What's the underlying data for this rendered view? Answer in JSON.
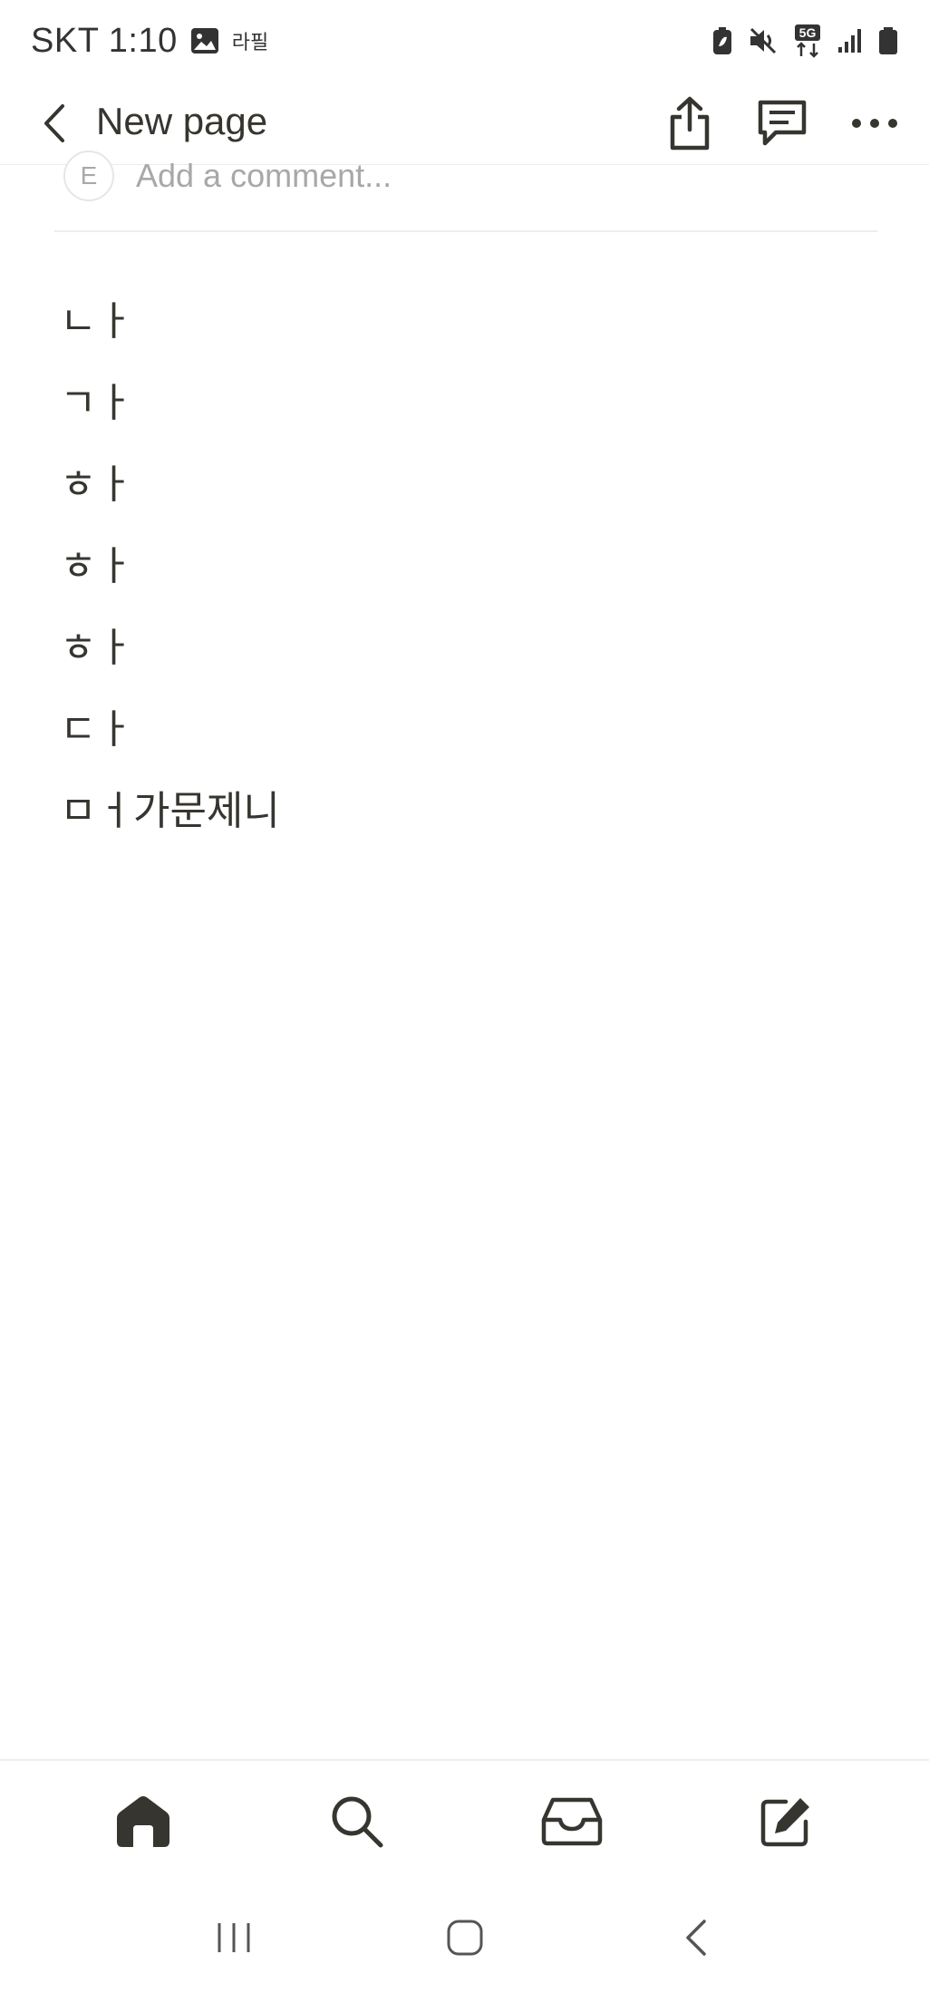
{
  "status_bar": {
    "carrier_time": "SKT 1:10",
    "notification_badge": "라필",
    "network": "5G",
    "icons": [
      "image-icon",
      "battery-saver-icon",
      "mute-icon",
      "5g-data-icon",
      "signal-icon",
      "battery-icon"
    ]
  },
  "app_bar": {
    "title": "New page",
    "actions": [
      "share-icon",
      "comment-icon",
      "more-icon"
    ]
  },
  "comment": {
    "avatar_initial": "E",
    "placeholder": "Add a comment..."
  },
  "content": {
    "lines": [
      "ㄴㅏ",
      "ㄱㅏ",
      "ㅎㅏ",
      "ㅎㅏ",
      "ㅎㅏ",
      "ㄷㅏ",
      "ㅁㅓ가문제니"
    ]
  },
  "bottom_nav": {
    "items": [
      "home-icon",
      "search-icon",
      "inbox-icon",
      "new-page-icon"
    ]
  },
  "system_nav": {
    "items": [
      "recents-icon",
      "home-button-icon",
      "back-icon"
    ]
  },
  "colors": {
    "text": "#37352f",
    "placeholder": "#a8a8a8",
    "divider": "#ededed"
  }
}
